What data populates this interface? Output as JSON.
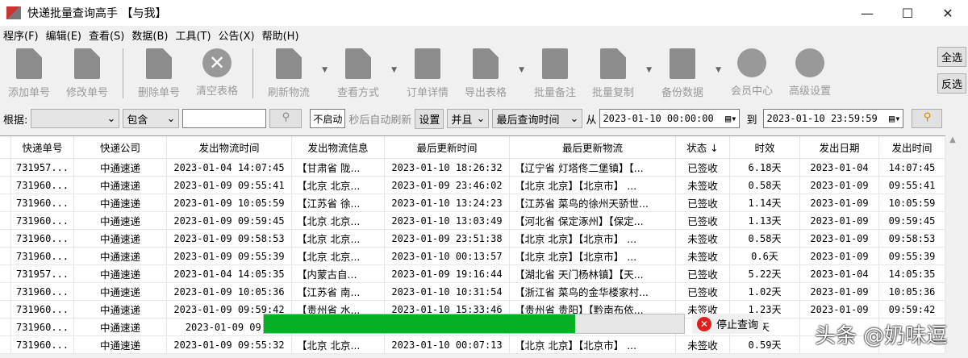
{
  "window": {
    "title": "快递批量查询高手 【与我】",
    "min": "—",
    "max": "☐",
    "close": "✕"
  },
  "menu": [
    "程序(F)",
    "编辑(E)",
    "查看(S)",
    "数据(B)",
    "工具(T)",
    "公告(X)",
    "帮助(H)"
  ],
  "toolbar": {
    "add": "添加单号",
    "edit": "修改单号",
    "delete": "删除单号",
    "clear": "清空表格",
    "refresh": "刷新物流",
    "view": "查看方式",
    "order": "订单详情",
    "export": "导出表格",
    "note": "批量备注",
    "copy": "批量复制",
    "backup": "备份数据",
    "member": "会员中心",
    "advanced": "高级设置",
    "select_all": "全选",
    "invert": "反选"
  },
  "filter": {
    "by_label": "根据:",
    "by_value": "",
    "match": "包含",
    "keyword": "",
    "auto": "不启动",
    "auto_label": "秒后自动刷新",
    "settings": "设置",
    "logic": "并且",
    "time_field": "最后查询时间",
    "from_label": "从",
    "from": "2023-01-10 00:00:00",
    "to_label": "到",
    "to": "2023-01-10 23:59:59"
  },
  "columns": [
    "快递单号",
    "快递公司",
    "发出物流时间",
    "发出物流信息",
    "最后更新时间",
    "最后更新物流",
    "状态 ↓",
    "时效",
    "发出日期",
    "发出时间"
  ],
  "rows": [
    [
      "731957...",
      "中通速递",
      "2023-01-04 14:07:45",
      "【甘肃省 陇...",
      "2023-01-10 18:26:32",
      "【辽宁省 灯塔佟二堡镇】【...",
      "已签收",
      "6.18天",
      "2023-01-04",
      "14:07:45"
    ],
    [
      "731960...",
      "中通速递",
      "2023-01-09 09:55:41",
      "【北京 北京...",
      "2023-01-09 23:46:02",
      "【北京 北京】【北京市】 ...",
      "未签收",
      "0.58天",
      "2023-01-09",
      "09:55:41"
    ],
    [
      "731960...",
      "中通速递",
      "2023-01-09 10:05:59",
      "【江苏省 徐...",
      "2023-01-10 13:24:23",
      "【江苏省 菜鸟的徐州天骄世...",
      "已签收",
      "1.14天",
      "2023-01-09",
      "10:05:59"
    ],
    [
      "731960...",
      "中通速递",
      "2023-01-09 09:59:45",
      "【北京 北京...",
      "2023-01-10 13:03:49",
      "【河北省 保定涿州】【保定...",
      "已签收",
      "1.13天",
      "2023-01-09",
      "09:59:45"
    ],
    [
      "731960...",
      "中通速递",
      "2023-01-09 09:58:53",
      "【北京 北京...",
      "2023-01-09 23:51:38",
      "【北京 北京】【北京市】 ...",
      "未签收",
      "0.58天",
      "2023-01-09",
      "09:58:53"
    ],
    [
      "731960...",
      "中通速递",
      "2023-01-09 09:55:39",
      "【北京 北京...",
      "2023-01-10 00:13:57",
      "【北京 北京】【北京市】 ...",
      "未签收",
      "0.6天",
      "2023-01-09",
      "09:55:39"
    ],
    [
      "731957...",
      "中通速递",
      "2023-01-04 14:05:35",
      "【内蒙古自...",
      "2023-01-09 19:16:44",
      "【湖北省 天门杨林镇】【天...",
      "已签收",
      "5.22天",
      "2023-01-04",
      "14:05:35"
    ],
    [
      "731960...",
      "中通速递",
      "2023-01-09 10:05:36",
      "【江苏省 南...",
      "2023-01-10 10:31:54",
      "【浙江省 菜鸟的金华楼家村...",
      "已签收",
      "1.02天",
      "2023-01-09",
      "10:05:36"
    ],
    [
      "731960...",
      "中通速递",
      "2023-01-09 09:59:42",
      "【贵州省 水...",
      "2023-01-10 15:33:46",
      "【贵州省 贵阳】【黔南布依...",
      "未签收",
      "1.23天",
      "2023-01-09",
      "09:59:42"
    ],
    [
      "731960...",
      "中通速递",
      "2023-01-09 09:5",
      "",
      "",
      "",
      "未",
      "天",
      "",
      ""
    ],
    [
      "731960...",
      "中通速递",
      "2023-01-09 09:55:32",
      "【北京 北京...",
      "2023-01-10 00:07:13",
      "【北京 北京】【北京市】 ...",
      "未签收",
      "0.59天",
      "",
      ""
    ]
  ],
  "progress": {
    "percent": 74,
    "stop_label": "停止查询"
  },
  "watermark": "头条 @奶味逗"
}
